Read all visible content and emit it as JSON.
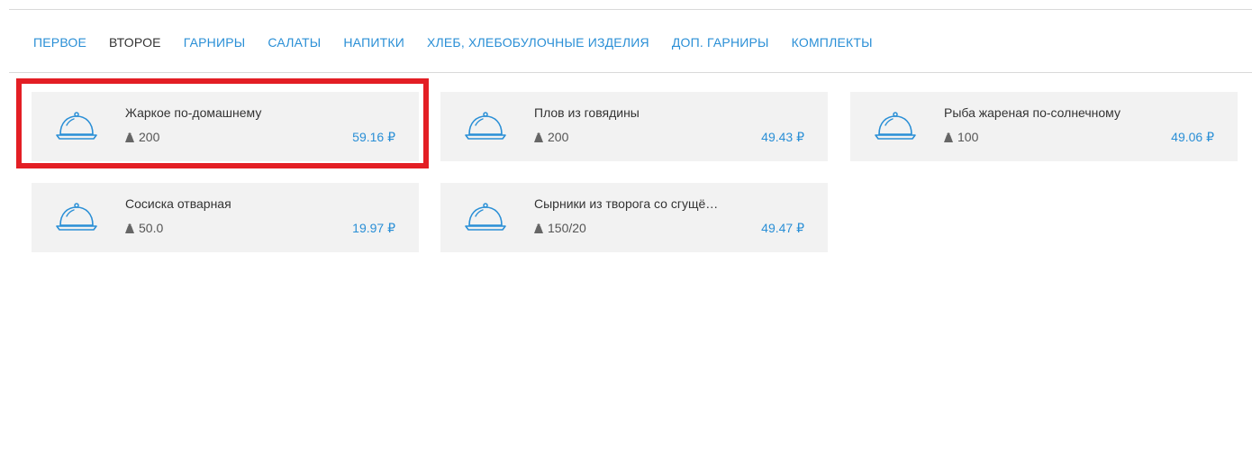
{
  "nav": {
    "items": [
      {
        "label": "ПЕРВОЕ",
        "state": "link"
      },
      {
        "label": "ВТОРОЕ",
        "state": "active"
      },
      {
        "label": "ГАРНИРЫ",
        "state": "link"
      },
      {
        "label": "САЛАТЫ",
        "state": "link"
      },
      {
        "label": "НАПИТКИ",
        "state": "link"
      },
      {
        "label": "ХЛЕБ, ХЛЕБОБУЛОЧНЫЕ ИЗДЕЛИЯ",
        "state": "link"
      },
      {
        "label": "ДОП. ГАРНИРЫ",
        "state": "link"
      },
      {
        "label": "КОМПЛЕКТЫ",
        "state": "link"
      }
    ]
  },
  "dishes": [
    {
      "name": "Жаркое по-домашнему",
      "weight": "200",
      "price": "59.16 ₽",
      "icon": "cloche-icon",
      "highlighted": true
    },
    {
      "name": "Плов из говядины",
      "weight": "200",
      "price": "49.43 ₽",
      "icon": "cloche-icon"
    },
    {
      "name": "Рыба жареная по-солнечному",
      "weight": "100",
      "price": "49.06 ₽",
      "icon": "cloche-icon"
    },
    {
      "name": "Сосиска отварная",
      "weight": "50.0",
      "price": "19.97 ₽",
      "icon": "cloche-icon"
    },
    {
      "name": "Сырники из творога со сгущённым молоком",
      "weight": "150/20",
      "price": "49.47 ₽",
      "icon": "cloche-icon"
    }
  ],
  "colors": {
    "accent": "#2a8fd6",
    "card_bg": "#f2f2f2",
    "highlight": "#e31e24",
    "text": "#333333"
  }
}
